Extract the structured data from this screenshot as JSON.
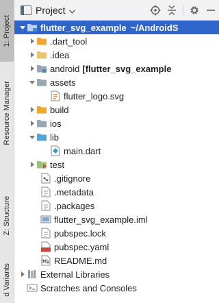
{
  "side_tabs": {
    "project": "1: Project",
    "resource_manager": "Resource Manager",
    "structure": "Z: Structure",
    "build_variants": "d Variants"
  },
  "header": {
    "title": "Project",
    "dropdown_icon": "chevron-down-icon",
    "tools": [
      "locate-icon",
      "collapse-all-icon",
      "gear-icon",
      "minimize-icon"
    ]
  },
  "tree": {
    "root": {
      "name": "flutter_svg_example",
      "path": "~/AndroidS"
    },
    "dart_tool": ".dart_tool",
    "idea": ".idea",
    "android": {
      "name": "android",
      "module": "[flutter_svg_example"
    },
    "assets": "assets",
    "flutter_logo": "flutter_logo.svg",
    "build": "build",
    "ios": "ios",
    "lib": "lib",
    "main_dart": "main.dart",
    "test": "test",
    "gitignore": ".gitignore",
    "metadata": ".metadata",
    "packages": ".packages",
    "iml": "flutter_svg_example.iml",
    "pubspec_lock": "pubspec.lock",
    "pubspec_yaml": "pubspec.yaml",
    "readme": "README.md",
    "external_libraries": "External Libraries",
    "scratches": "Scratches and Consoles"
  },
  "colors": {
    "selection": "#2f65ca",
    "folder_yellow": "#e8c56a",
    "folder_gray": "#9aa7b0",
    "folder_blue": "#6fa8dc",
    "source_folder": "#56a5d8",
    "excluded_orange": "#f0a732"
  }
}
